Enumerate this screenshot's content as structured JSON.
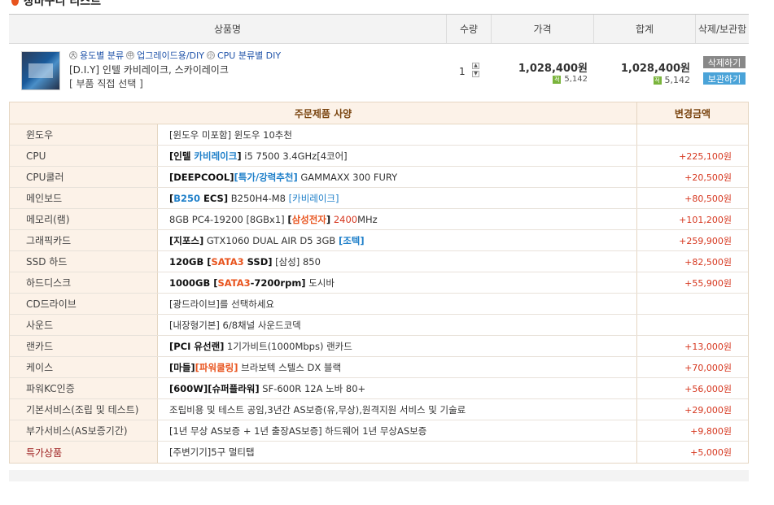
{
  "page": {
    "title": "장바구니 리스트"
  },
  "cart_header": {
    "name": "상품명",
    "qty": "수량",
    "price": "가격",
    "total": "합계",
    "actions": "삭제/보관함"
  },
  "cart_item": {
    "thumbnail_icon": "product-thumbnail",
    "categories": [
      {
        "icon": "大",
        "label": "용도별 분류"
      },
      {
        "icon": "中",
        "label": "업그레이드용/DIY"
      },
      {
        "icon": "小",
        "label": "CPU 분류별 DIY"
      }
    ],
    "name": "[D.I.Y] 인텔 카비레이크, 스카이레이크",
    "link": "[ 부품 직접 선택 ]",
    "qty": "1",
    "price": "1,028,400원",
    "price_points": "5,142",
    "total": "1,028,400원",
    "total_points": "5,142",
    "delete_label": "삭제하기",
    "keep_label": "보관하기"
  },
  "spec_table": {
    "header_main": "주문제품 사양",
    "header_price": "변경금액",
    "rows": [
      {
        "category": "윈도우",
        "parts": [
          {
            "t": "[윈도우 미포함] 윈도우 10추천"
          }
        ],
        "price": ""
      },
      {
        "category": "CPU",
        "parts": [
          {
            "t": "[인텔 ",
            "s": "b"
          },
          {
            "t": "카비레이크",
            "s": "blue"
          },
          {
            "t": "]",
            "s": "b"
          },
          {
            "t": " i5 7500 3.4GHz[4코어]"
          }
        ],
        "price": "+225,100원"
      },
      {
        "category": "CPU쿨러",
        "parts": [
          {
            "t": "[DEEPCOOL]",
            "s": "b"
          },
          {
            "t": "[특가/강력추천]",
            "s": "blue"
          },
          {
            "t": " GAMMAXX 300 FURY"
          }
        ],
        "price": "+20,500원"
      },
      {
        "category": "메인보드",
        "parts": [
          {
            "t": "[",
            "s": "b"
          },
          {
            "t": "B250",
            "s": "blue"
          },
          {
            "t": " ECS]",
            "s": "b"
          },
          {
            "t": " B250H4-M8 "
          },
          {
            "t": "[카비레이크]",
            "s": "blue-n"
          }
        ],
        "price": "+80,500원"
      },
      {
        "category": "메모리(램)",
        "parts": [
          {
            "t": "8GB PC4-19200 [8GBx1] "
          },
          {
            "t": "[",
            "s": "b"
          },
          {
            "t": "삼성전자",
            "s": "orange"
          },
          {
            "t": "]",
            "s": "b"
          },
          {
            "t": " "
          },
          {
            "t": "2400",
            "s": "red"
          },
          {
            "t": "MHz"
          }
        ],
        "price": "+101,200원"
      },
      {
        "category": "그래픽카드",
        "parts": [
          {
            "t": "[지포스]",
            "s": "b"
          },
          {
            "t": " GTX1060 DUAL AIR D5 3GB "
          },
          {
            "t": "[조텍]",
            "s": "blue"
          }
        ],
        "price": "+259,900원"
      },
      {
        "category": "SSD 하드",
        "parts": [
          {
            "t": "120GB [",
            "s": "b"
          },
          {
            "t": "SATA3",
            "s": "orange"
          },
          {
            "t": " SSD]",
            "s": "b"
          },
          {
            "t": " [삼성] 850"
          }
        ],
        "price": "+82,500원"
      },
      {
        "category": "하드디스크",
        "parts": [
          {
            "t": "1000GB [",
            "s": "b"
          },
          {
            "t": "SATA3",
            "s": "orange"
          },
          {
            "t": "-7200rpm]",
            "s": "b"
          },
          {
            "t": " 도시바"
          }
        ],
        "price": "+55,900원"
      },
      {
        "category": "CD드라이브",
        "parts": [
          {
            "t": "[광드라이브]를 선택하세요"
          }
        ],
        "price": ""
      },
      {
        "category": "사운드",
        "parts": [
          {
            "t": "[내장형기본] 6/8채널 사운드코덱"
          }
        ],
        "price": ""
      },
      {
        "category": "랜카드",
        "parts": [
          {
            "t": "[PCI 유선랜]",
            "s": "b"
          },
          {
            "t": " 1기가비트(1000Mbps) 랜카드"
          }
        ],
        "price": "+13,000원"
      },
      {
        "category": "케이스",
        "parts": [
          {
            "t": "[마들]",
            "s": "b"
          },
          {
            "t": "[파워쿨링]",
            "s": "orange"
          },
          {
            "t": " 브라보텍 스텔스 DX 블랙"
          }
        ],
        "price": "+70,000원"
      },
      {
        "category": "파워KC인증",
        "parts": [
          {
            "t": "[600W][슈퍼플라워]",
            "s": "b"
          },
          {
            "t": " SF-600R 12A 노바 80+"
          }
        ],
        "price": "+56,000원"
      },
      {
        "category": "기본서비스(조립 및 테스트)",
        "parts": [
          {
            "t": "조립비용 및 테스트 공임,3년간 AS보증(유,무상),원격지원 서비스 및 기술료"
          }
        ],
        "price": "+29,000원"
      },
      {
        "category": "부가서비스(AS보증기간)",
        "parts": [
          {
            "t": "[1년 무상 AS보증 + 1년 출장AS보증] 하드웨어 1년 무상AS보증"
          }
        ],
        "price": "+9,800원"
      },
      {
        "category": "특가상품",
        "special": true,
        "parts": [
          {
            "t": "[주변기기]5구 멀티탭"
          }
        ],
        "price": "+5,000원"
      }
    ]
  },
  "colors": {
    "accent_orange": "#e8541e",
    "link_blue": "#1e7fc9",
    "price_red": "#d6361e",
    "header_beige": "#fcf2e8",
    "btn_gray": "#888888",
    "btn_blue": "#4aa3d8"
  }
}
